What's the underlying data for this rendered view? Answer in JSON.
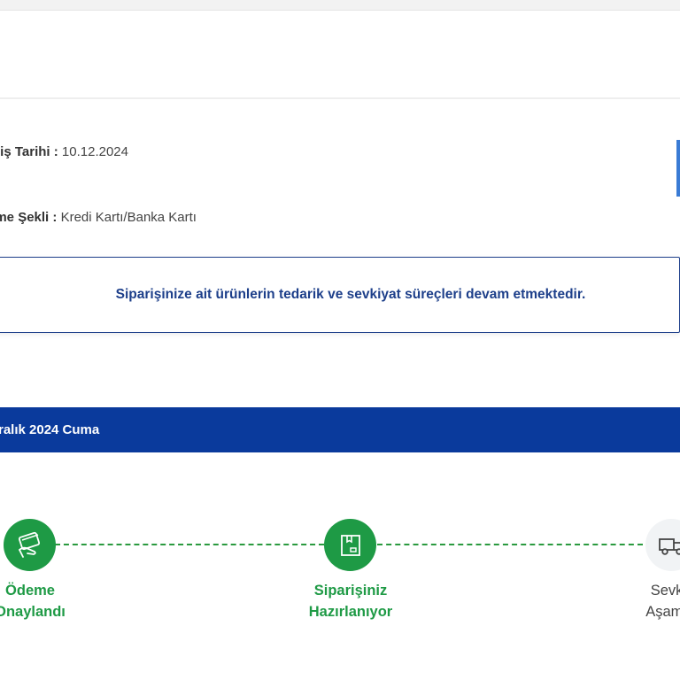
{
  "order_info": {
    "date_label": "ariş Tarihi :",
    "date_value": "10.12.2024",
    "payment_label": "eme Şekli :",
    "payment_value": "Kredi Kartı/Banka Kartı"
  },
  "notice": {
    "text": "Siparişinize ait ürünlerin tedarik ve sevkiyat süreçleri devam etmektedir."
  },
  "delivery_bar": {
    "text": "ralık 2024 Cuma"
  },
  "tracker": {
    "steps": [
      {
        "line1": "Ödeme",
        "line2": "Onaylandı",
        "status": "done",
        "icon": "card-hand-icon"
      },
      {
        "line1": "Siparişiniz",
        "line2": "Hazırlanıyor",
        "status": "done",
        "icon": "box-icon"
      },
      {
        "line1": "Sevkiy",
        "line2": "Aşamas",
        "status": "pending",
        "icon": "truck-icon"
      }
    ]
  },
  "colors": {
    "green": "#1e9a45",
    "navy": "#0a3a9c",
    "notice_text": "#1d3f8a"
  }
}
